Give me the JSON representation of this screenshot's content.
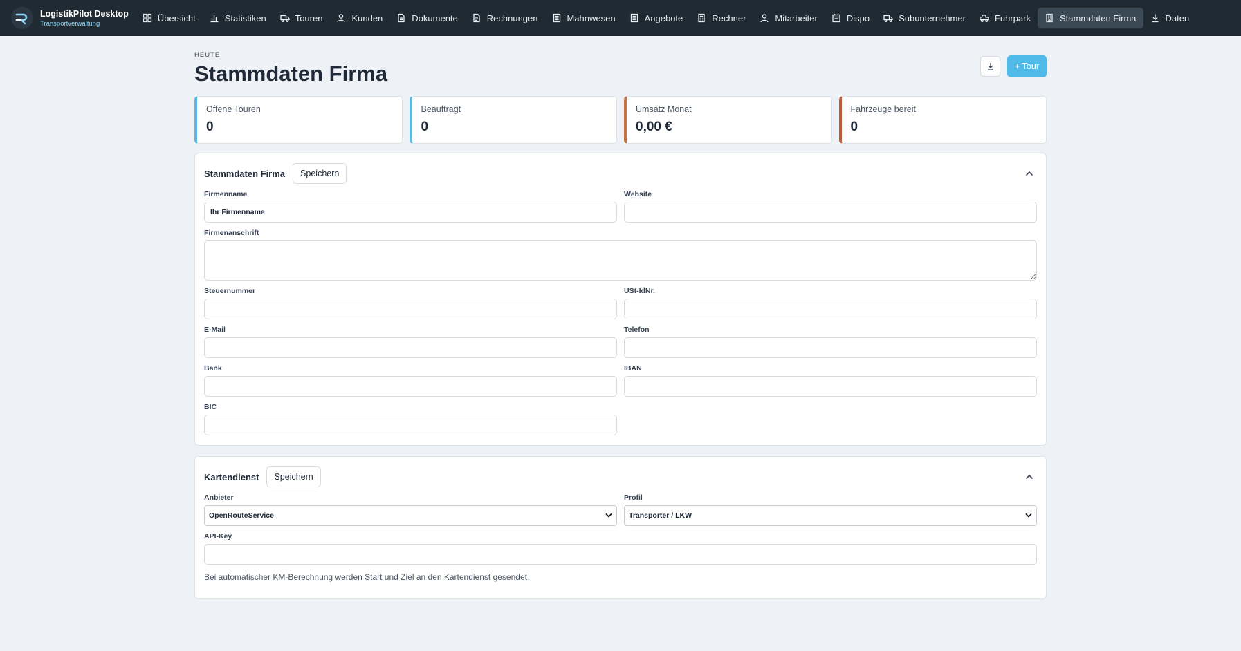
{
  "app": {
    "title": "LogistikPilot Desktop",
    "subtitle": "Transportverwaltung"
  },
  "nav": {
    "items": [
      {
        "label": "Übersicht",
        "icon": "grid-icon"
      },
      {
        "label": "Statistiken",
        "icon": "bar-chart-icon"
      },
      {
        "label": "Touren",
        "icon": "truck-icon"
      },
      {
        "label": "Kunden",
        "icon": "user-icon"
      },
      {
        "label": "Dokumente",
        "icon": "document-icon"
      },
      {
        "label": "Rechnungen",
        "icon": "invoice-icon"
      },
      {
        "label": "Mahnwesen",
        "icon": "list-document-icon"
      },
      {
        "label": "Angebote",
        "icon": "list-document-icon"
      },
      {
        "label": "Rechner",
        "icon": "calculator-icon"
      },
      {
        "label": "Mitarbeiter",
        "icon": "person-icon"
      },
      {
        "label": "Dispo",
        "icon": "calendar-icon"
      },
      {
        "label": "Subunternehmer",
        "icon": "truck-icon"
      },
      {
        "label": "Fuhrpark",
        "icon": "vehicle-icon"
      },
      {
        "label": "Stammdaten Firma",
        "icon": "building-icon"
      },
      {
        "label": "Daten",
        "icon": "download-icon"
      }
    ],
    "active_index": 13
  },
  "page": {
    "eyebrow": "HEUTE",
    "title": "Stammdaten Firma",
    "new_tour_label": "+ Tour"
  },
  "stats": [
    {
      "label": "Offene Touren",
      "value": "0",
      "accent": "#5bb8df"
    },
    {
      "label": "Beauftragt",
      "value": "0",
      "accent": "#5bb8df"
    },
    {
      "label": "Umsatz Monat",
      "value": "0,00 €",
      "accent": "#c8733f"
    },
    {
      "label": "Fahrzeuge bereit",
      "value": "0",
      "accent": "#b8603a"
    }
  ],
  "company": {
    "title": "Stammdaten Firma",
    "save_label": "Speichern",
    "fields": {
      "firmenname": {
        "label": "Firmenname",
        "value": "Ihr Firmenname"
      },
      "website": {
        "label": "Website",
        "value": ""
      },
      "anschrift": {
        "label": "Firmenanschrift",
        "value": ""
      },
      "steuernummer": {
        "label": "Steuernummer",
        "value": ""
      },
      "ustid": {
        "label": "USt-IdNr.",
        "value": ""
      },
      "email": {
        "label": "E-Mail",
        "value": ""
      },
      "telefon": {
        "label": "Telefon",
        "value": ""
      },
      "bank": {
        "label": "Bank",
        "value": ""
      },
      "iban": {
        "label": "IBAN",
        "value": ""
      },
      "bic": {
        "label": "BIC",
        "value": ""
      }
    }
  },
  "map": {
    "title": "Kartendienst",
    "save_label": "Speichern",
    "anbieter": {
      "label": "Anbieter",
      "value": "OpenRouteService"
    },
    "profil": {
      "label": "Profil",
      "value": "Transporter / LKW"
    },
    "apikey": {
      "label": "API-Key",
      "value": ""
    },
    "hint": "Bei automatischer KM-Berechnung werden Start und Ziel an den Kartendienst gesendet."
  },
  "colors": {
    "topbar": "#1f2a33",
    "primary": "#4fb9e8",
    "background": "#eef1f5"
  }
}
